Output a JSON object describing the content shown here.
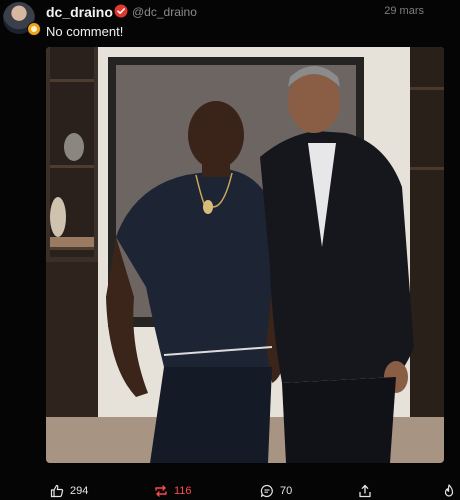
{
  "post": {
    "author_name": "dc_draino",
    "author_handle": "@dc_draino",
    "date": "29 mars",
    "text": "No comment!",
    "likes": "294",
    "reposts": "116",
    "replies": "70"
  },
  "icons": {
    "avatar": "avatar",
    "verified": "verified-badge-icon",
    "like": "thumbs-up-icon",
    "repost": "repost-icon",
    "reply": "comment-icon",
    "share": "share-icon",
    "boost": "flame-icon"
  },
  "colors": {
    "background": "#050505",
    "accent": "#ff4a4a",
    "muted": "#8b8b8b"
  }
}
